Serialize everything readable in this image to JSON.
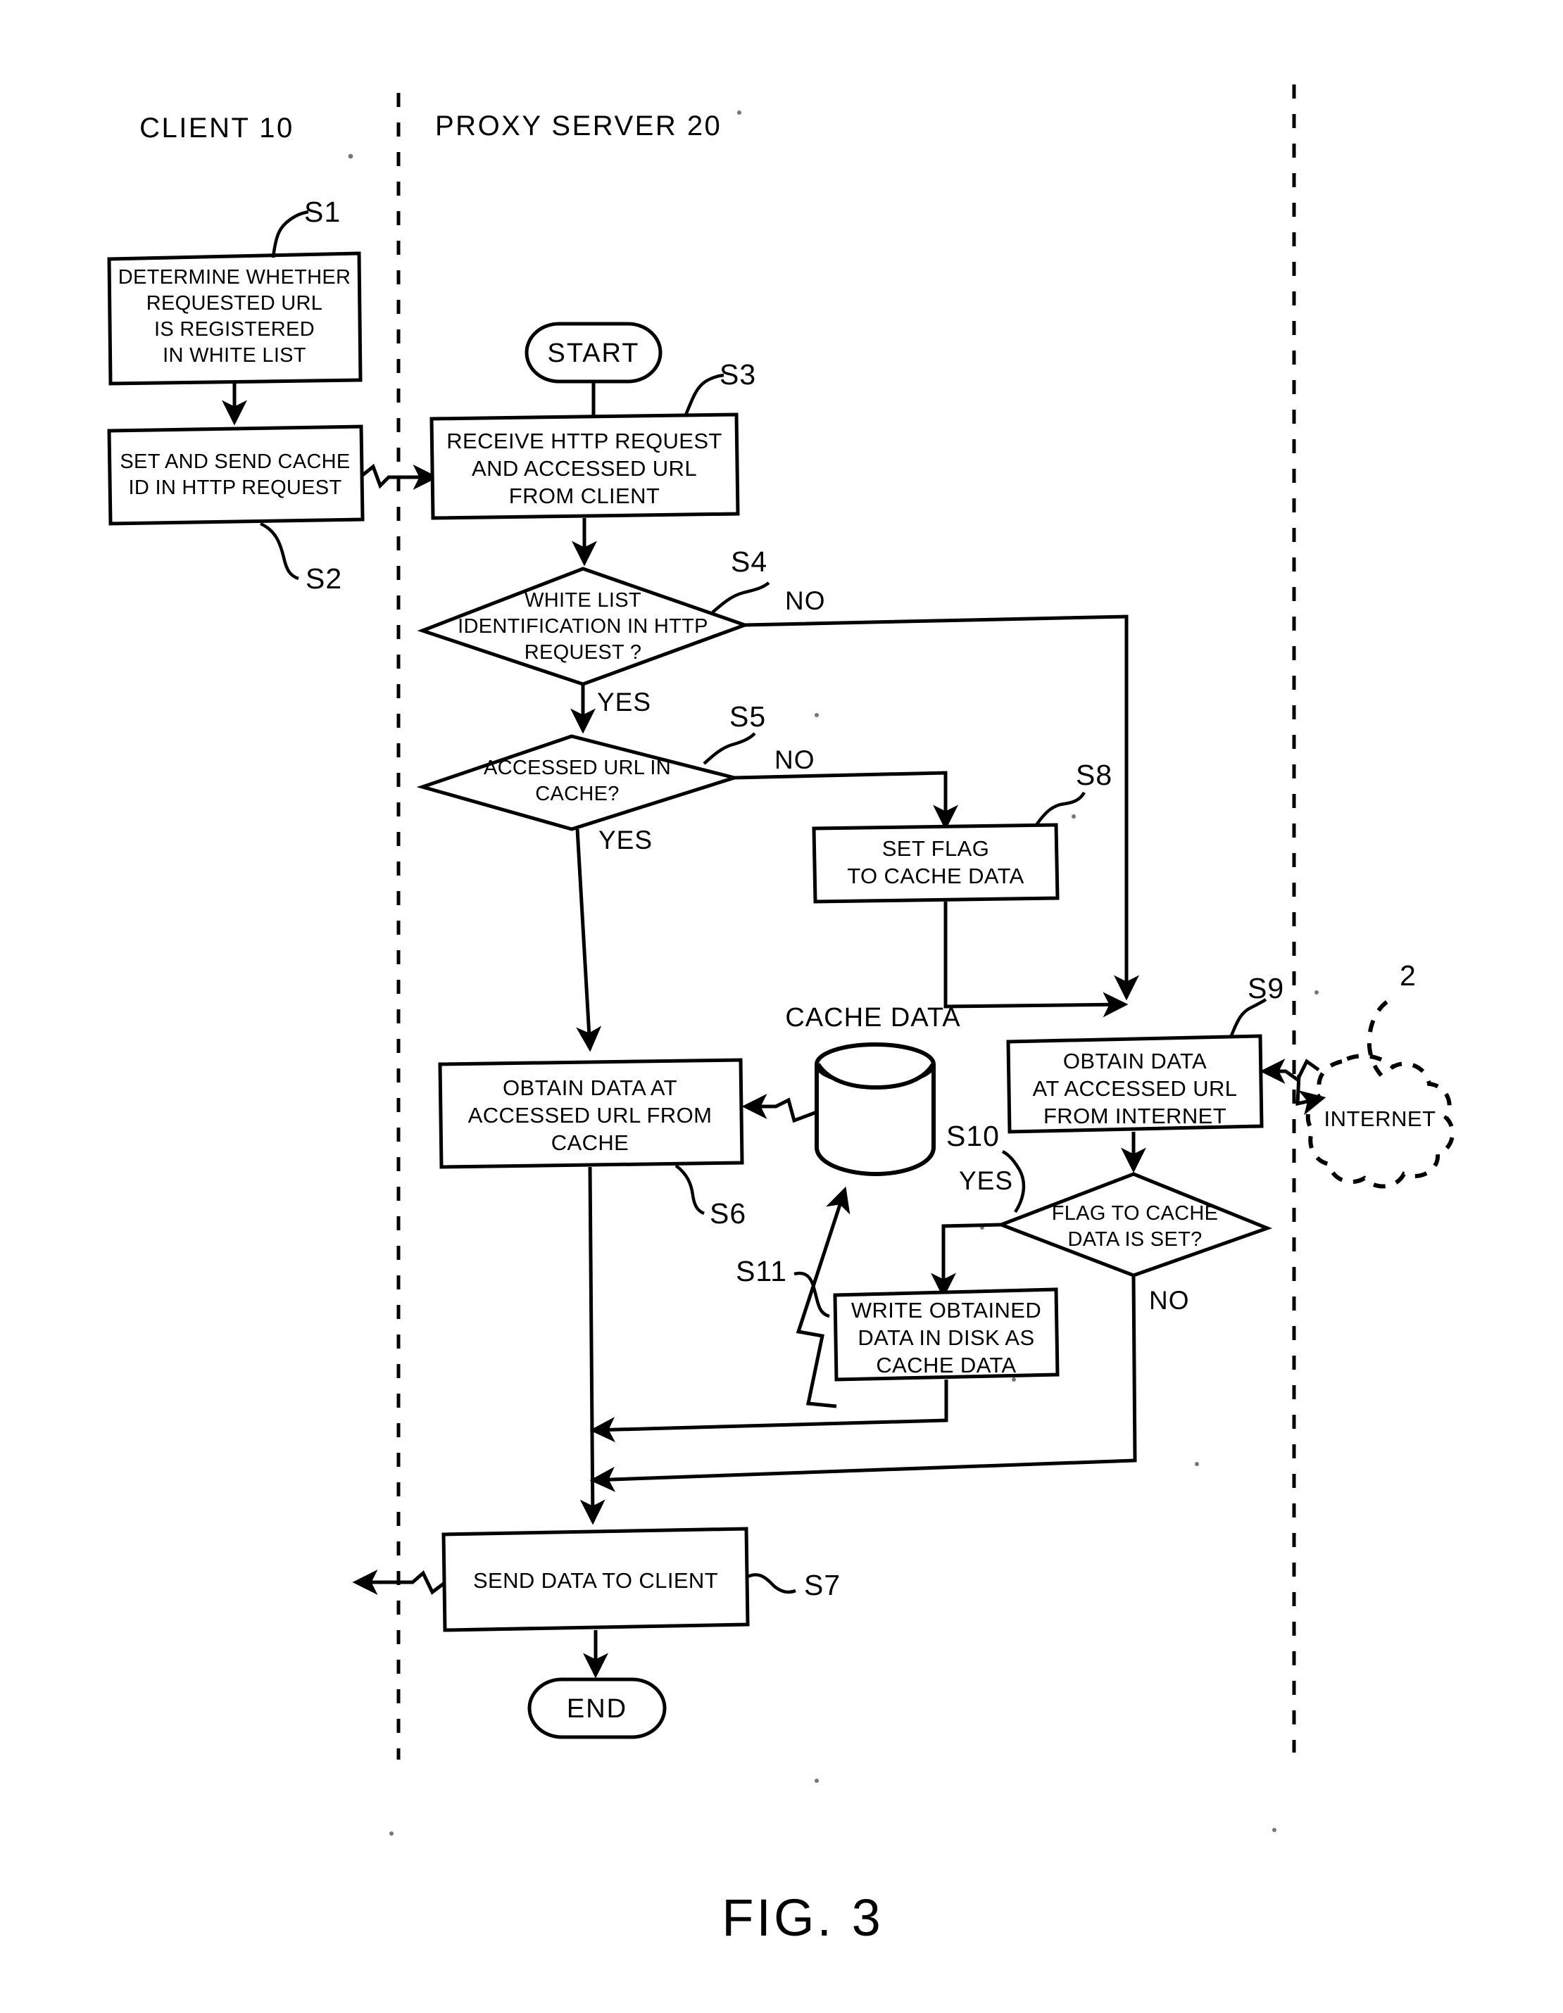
{
  "figure": {
    "caption": "FIG. 3"
  },
  "lanes": [
    {
      "id": "client",
      "label": "CLIENT 10"
    },
    {
      "id": "proxy",
      "label": "PROXY SERVER 20"
    }
  ],
  "terminals": {
    "start": "START",
    "end": "END"
  },
  "nodes": [
    {
      "id": "S1",
      "step": "S1",
      "kind": "process",
      "lane": "client",
      "lines": [
        "DETERMINE WHETHER",
        "REQUESTED URL",
        "IS REGISTERED",
        "IN WHITE LIST"
      ]
    },
    {
      "id": "S2",
      "step": "S2",
      "kind": "process",
      "lane": "client",
      "lines": [
        "SET AND SEND CACHE",
        "ID IN HTTP REQUEST"
      ]
    },
    {
      "id": "S3",
      "step": "S3",
      "kind": "process",
      "lane": "proxy",
      "lines": [
        "RECEIVE HTTP REQUEST",
        "AND ACCESSED URL",
        "FROM CLIENT"
      ]
    },
    {
      "id": "S4",
      "step": "S4",
      "kind": "decision",
      "lane": "proxy",
      "lines": [
        "WHITE LIST",
        "IDENTIFICATION IN HTTP",
        "REQUEST ?"
      ],
      "branch_yes": "YES",
      "branch_no": "NO"
    },
    {
      "id": "S5",
      "step": "S5",
      "kind": "decision",
      "lane": "proxy",
      "lines": [
        "ACCESSED URL IN",
        "CACHE?"
      ],
      "branch_yes": "YES",
      "branch_no": "NO"
    },
    {
      "id": "S8",
      "step": "S8",
      "kind": "process",
      "lane": "proxy",
      "lines": [
        "SET FLAG",
        "TO CACHE DATA"
      ]
    },
    {
      "id": "S9",
      "step": "S9",
      "kind": "process",
      "lane": "proxy",
      "lines": [
        "OBTAIN DATA",
        "AT ACCESSED URL",
        "FROM INTERNET"
      ]
    },
    {
      "id": "S6",
      "step": "S6",
      "kind": "process",
      "lane": "proxy",
      "lines": [
        "OBTAIN DATA AT",
        "ACCESSED URL FROM",
        "CACHE"
      ]
    },
    {
      "id": "S10",
      "step": "S10",
      "kind": "decision",
      "lane": "proxy",
      "lines": [
        "FLAG TO CACHE",
        "DATA IS SET?"
      ],
      "branch_yes": "YES",
      "branch_no": "NO"
    },
    {
      "id": "S11",
      "step": "S11",
      "kind": "process",
      "lane": "proxy",
      "lines": [
        "WRITE OBTAINED",
        "DATA IN DISK AS",
        "CACHE DATA"
      ]
    },
    {
      "id": "S7",
      "step": "S7",
      "kind": "process",
      "lane": "proxy",
      "lines": [
        "SEND DATA TO CLIENT"
      ]
    }
  ],
  "store": {
    "label": "CACHE DATA"
  },
  "external": {
    "cloud_label": "INTERNET",
    "cloud_ref": "2"
  },
  "branch_labels": {
    "s4_no": "NO",
    "s4_yes": "YES",
    "s5_no": "NO",
    "s5_yes": "YES",
    "s10_yes": "YES",
    "s10_no": "NO"
  },
  "step_labels": {
    "s1": "S1",
    "s2": "S2",
    "s3": "S3",
    "s4": "S4",
    "s5": "S5",
    "s6": "S6",
    "s7": "S7",
    "s8": "S8",
    "s9": "S9",
    "s10": "S10",
    "s11": "S11"
  },
  "colors": {
    "ink": "#000000",
    "paper": "#ffffff"
  }
}
